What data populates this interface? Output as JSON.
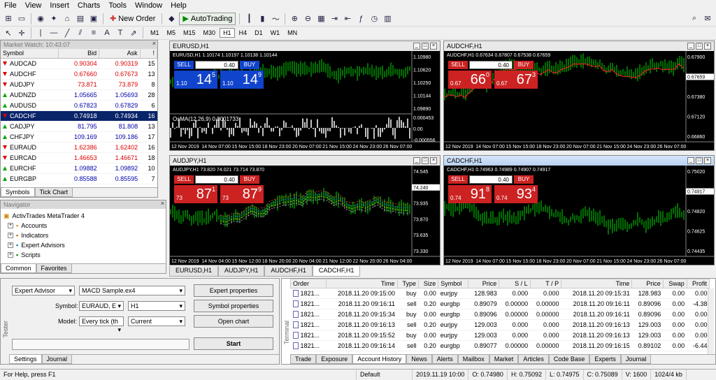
{
  "menu": [
    "File",
    "View",
    "Insert",
    "Charts",
    "Tools",
    "Window",
    "Help"
  ],
  "toolbar": {
    "new_order": "New Order",
    "autotrading": "AutoTrading"
  },
  "timeframes": [
    "M1",
    "M5",
    "M15",
    "M30",
    "H1",
    "H4",
    "D1",
    "W1",
    "MN"
  ],
  "active_timeframe": "H1",
  "market_watch": {
    "title": "Market Watch: 10:43:07",
    "headers": [
      "Symbol",
      "Bid",
      "Ask",
      "!"
    ],
    "rows": [
      {
        "symbol": "AUDCAD",
        "bid": "0.90304",
        "ask": "0.90319",
        "spread": "15",
        "dir": "down"
      },
      {
        "symbol": "AUDCHF",
        "bid": "0.67660",
        "ask": "0.67673",
        "spread": "13",
        "dir": "down"
      },
      {
        "symbol": "AUDJPY",
        "bid": "73.871",
        "ask": "73.879",
        "spread": "8",
        "dir": "down"
      },
      {
        "symbol": "AUDNZD",
        "bid": "1.05665",
        "ask": "1.05693",
        "spread": "28",
        "dir": "up"
      },
      {
        "symbol": "AUDUSD",
        "bid": "0.67823",
        "ask": "0.67829",
        "spread": "6",
        "dir": "up"
      },
      {
        "symbol": "CADCHF",
        "bid": "0.74918",
        "ask": "0.74934",
        "spread": "16",
        "dir": "down",
        "selected": true
      },
      {
        "symbol": "CADJPY",
        "bid": "81.795",
        "ask": "81.808",
        "spread": "13",
        "dir": "up"
      },
      {
        "symbol": "CHFJPY",
        "bid": "109.169",
        "ask": "109.186",
        "spread": "17",
        "dir": "up"
      },
      {
        "symbol": "EURAUD",
        "bid": "1.62386",
        "ask": "1.62402",
        "spread": "16",
        "dir": "down"
      },
      {
        "symbol": "EURCAD",
        "bid": "1.46653",
        "ask": "1.46671",
        "spread": "18",
        "dir": "down"
      },
      {
        "symbol": "EURCHF",
        "bid": "1.09882",
        "ask": "1.09892",
        "spread": "10",
        "dir": "up"
      },
      {
        "symbol": "EURGBP",
        "bid": "0.85588",
        "ask": "0.85595",
        "spread": "7",
        "dir": "up"
      }
    ],
    "tabs": [
      "Symbols",
      "Tick Chart"
    ]
  },
  "navigator": {
    "title": "Navigator",
    "items": [
      "ActivTrades MetaTrader 4",
      "Accounts",
      "Indicators",
      "Expert Advisors",
      "Scripts"
    ],
    "tabs": [
      "Common",
      "Favorites"
    ]
  },
  "charts": [
    {
      "title": "EURUSD,H1",
      "info": "EURUSD,H1  1.10174 1.10197 1.10138 1.10144",
      "lot": "0.40",
      "sell_label": "SELL",
      "buy_label": "BUY",
      "sell": {
        "pre": "1.10",
        "big": "14",
        "sup": "5"
      },
      "buy": {
        "pre": "1.10",
        "big": "14",
        "sup": "9"
      },
      "prices": [
        "1.10980",
        "1.10620",
        "1.10250",
        "1.10144",
        "1.09890"
      ],
      "sub_info": "OsMA(12,26,9) 0.0001733",
      "sub_prices": [
        "0.000453",
        "0.00",
        "-0.000556"
      ],
      "dates": [
        "12 Nov 2019",
        "14 Nov 07:00",
        "15 Nov 15:00",
        "18 Nov 23:00",
        "20 Nov 07:00",
        "21 Nov 15:00",
        "24 Nov 23:00",
        "26 Nov 07:00"
      ]
    },
    {
      "title": "AUDCHF,H1",
      "info": "AUDCHF,H1  0.67634 0.67807 0.67538 0.67659",
      "lot": "0.40",
      "sell_label": "SELL",
      "buy_label": "BUY",
      "sell": {
        "pre": "0.67",
        "big": "66",
        "sup": "0"
      },
      "buy": {
        "pre": "0.67",
        "big": "67",
        "sup": "3"
      },
      "prices": [
        "0.67900",
        "0.67659",
        "0.67380",
        "0.67120",
        "0.66860"
      ],
      "dates": [
        "12 Nov 2019",
        "14 Nov 07:00",
        "15 Nov 15:00",
        "18 Nov 23:00",
        "20 Nov 07:00",
        "21 Nov 15:00",
        "24 Nov 23:00",
        "26 Nov 07:00"
      ]
    },
    {
      "title": "AUDJPY,H1",
      "info": "AUDJPY,H1  73.820 74.021 73.714 73.870",
      "lot": "0.40",
      "sell_label": "SELL",
      "buy_label": "BUY",
      "sell": {
        "pre": "73",
        "big": "87",
        "sup": "1"
      },
      "buy": {
        "pre": "73",
        "big": "87",
        "sup": "9"
      },
      "prices": [
        "74.545",
        "74.240",
        "73.935",
        "73.870",
        "73.635",
        "73.330"
      ],
      "dates": [
        "12 Nov 2019",
        "14 Nov 04:00",
        "15 Nov 12:00",
        "18 Nov 20:00",
        "20 Nov 04:00",
        "21 Nov 12:00",
        "22 Nov 20:00",
        "26 Nov 04:00"
      ]
    },
    {
      "title": "CADCHF,H1",
      "info": "CADCHF,H1  0.74963 0.74989 0.74907 0.74917",
      "lot": "0.40",
      "sell_label": "SELL",
      "buy_label": "BUY",
      "sell": {
        "pre": "0.74",
        "big": "91",
        "sup": "8"
      },
      "buy": {
        "pre": "0.74",
        "big": "93",
        "sup": "4"
      },
      "prices": [
        "0.75020",
        "0.74917",
        "0.74820",
        "0.74625",
        "0.74435"
      ],
      "dates": [
        "12 Nov 2019",
        "14 Nov 07:00",
        "15 Nov 15:00",
        "18 Nov 23:00",
        "20 Nov 07:00",
        "21 Nov 15:00",
        "24 Nov 23:00",
        "26 Nov 07:00"
      ]
    }
  ],
  "chart_tabs": [
    "EURUSD,H1",
    "AUDJPY,H1",
    "AUDCHF,H1",
    "CADCHF,H1"
  ],
  "tester": {
    "type": "Expert Advisor",
    "expert": "MACD Sample.ex4",
    "symbol_label": "Symbol:",
    "symbol": "EURAUD, E",
    "period": "H1",
    "model_label": "Model:",
    "model": "Every tick (th",
    "spread": "Current",
    "btn_expert": "Expert properties",
    "btn_symbol": "Symbol properties",
    "btn_chart": "Open chart",
    "btn_start": "Start",
    "tabs": [
      "Settings",
      "Journal"
    ],
    "side_label": "Tester"
  },
  "terminal": {
    "headers": [
      "Order",
      "Time",
      "Type",
      "Size",
      "Symbol",
      "Price",
      "S / L",
      "T / P",
      "Time",
      "Price",
      "Swap",
      "Profit"
    ],
    "rows": [
      [
        "1821...",
        "2018.11.20 09:15:00",
        "buy",
        "0.00",
        "eurjpy",
        "128.983",
        "0.000",
        "0.000",
        "2018.11.20 09:15:31",
        "128.983",
        "0.00",
        "0.00"
      ],
      [
        "1821...",
        "2018.11.20 09:16:11",
        "sell",
        "0.20",
        "eurgbp",
        "0.89079",
        "0.00000",
        "0.00000",
        "2018.11.20 09:16:11",
        "0.89096",
        "0.00",
        "-4.38"
      ],
      [
        "1821...",
        "2018.11.20 09:15:34",
        "buy",
        "0.00",
        "eurgbp",
        "0.89096",
        "0.00000",
        "0.00000",
        "2018.11.20 09:16:11",
        "0.89096",
        "0.00",
        "0.00"
      ],
      [
        "1821...",
        "2018.11.20 09:16:13",
        "sell",
        "0.20",
        "eurjpy",
        "129.003",
        "0.000",
        "0.000",
        "2018.11.20 09:16:13",
        "129.003",
        "0.00",
        "0.00"
      ],
      [
        "1821...",
        "2018.11.20 09:15:52",
        "buy",
        "0.00",
        "eurjpy",
        "129.003",
        "0.000",
        "0.000",
        "2018.11.20 09:16:13",
        "129.003",
        "0.00",
        "0.00"
      ],
      [
        "1821...",
        "2018.11.20 09:16:14",
        "sell",
        "0.20",
        "eurgbp",
        "0.89077",
        "0.00000",
        "0.00000",
        "2018.11.20 09:16:15",
        "0.89102",
        "0.00",
        "-6.44"
      ]
    ],
    "tabs": [
      "Trade",
      "Exposure",
      "Account History",
      "News",
      "Alerts",
      "Mailbox",
      "Market",
      "Articles",
      "Code Base",
      "Experts",
      "Journal"
    ],
    "active_tab": "Account History",
    "side_label": "Terminal"
  },
  "status": [
    "For Help, press F1",
    "Default",
    "2019.11.19 10:00",
    "O: 0.74980",
    "H: 0.75092",
    "L: 0.74975",
    "C: 0.75089",
    "V: 1600",
    "1024/4 kb"
  ],
  "colors": {
    "chart_bg": "#000000",
    "candle": "#00dd00",
    "sell": "#cc2222",
    "buy": "#1144cc",
    "selected_row": "#0a246a"
  }
}
